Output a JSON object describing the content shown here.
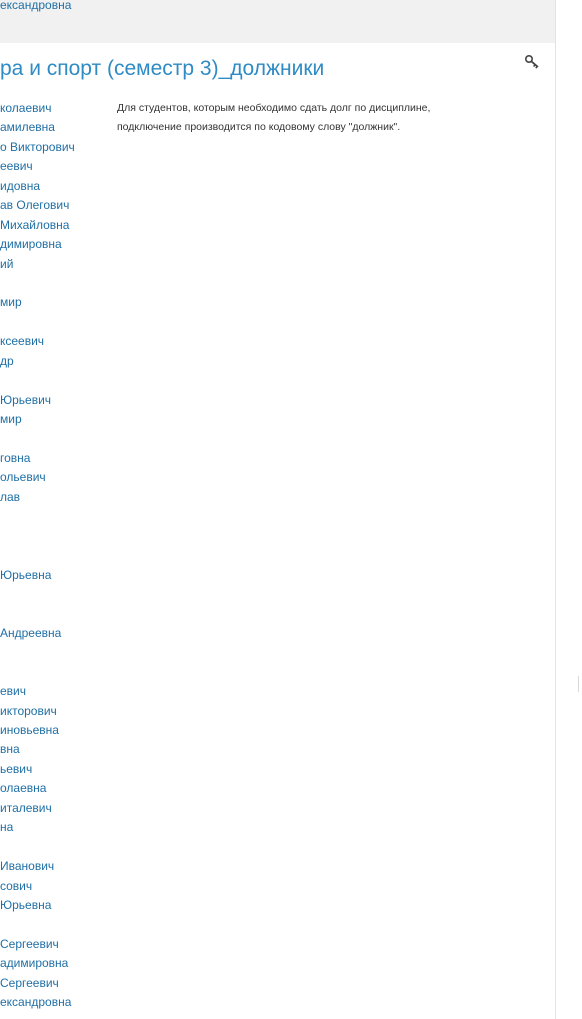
{
  "header": {
    "top_teacher": "ександровна"
  },
  "course": {
    "title": "ра и спорт (семестр 3)_должники",
    "summary_line1": "Для студентов, которым необходимо сдать долг по дисциплине,",
    "summary_line2": "подключение производится по кодовому слову \"должник\".",
    "enrol_icon": "key-icon"
  },
  "teachers": [
    "колаевич",
    "амилевна",
    "о Викторович",
    "еевич",
    "идовна",
    "ав Олегович",
    "Михайловна",
    "димировна",
    "ий",
    "",
    "мир",
    "",
    "ксеевич",
    "др",
    "",
    "Юрьевич",
    "мир",
    "",
    "говна",
    "ольевич",
    "лав",
    "",
    "",
    "",
    "Юрьевна",
    "",
    "",
    "Андреевна",
    "",
    "",
    "евич",
    "икторович",
    "иновьевна",
    "вна",
    "ьевич",
    "олаевна",
    "италевич",
    "на",
    "",
    "Иванович",
    "сович",
    "Юрьевна",
    "",
    "Сергеевич",
    "адимировна",
    "Сергеевич",
    "ександровна"
  ],
  "colors": {
    "link": "#1f6fa5",
    "title": "#2e8bc4",
    "panel": "#f1f1f1"
  }
}
